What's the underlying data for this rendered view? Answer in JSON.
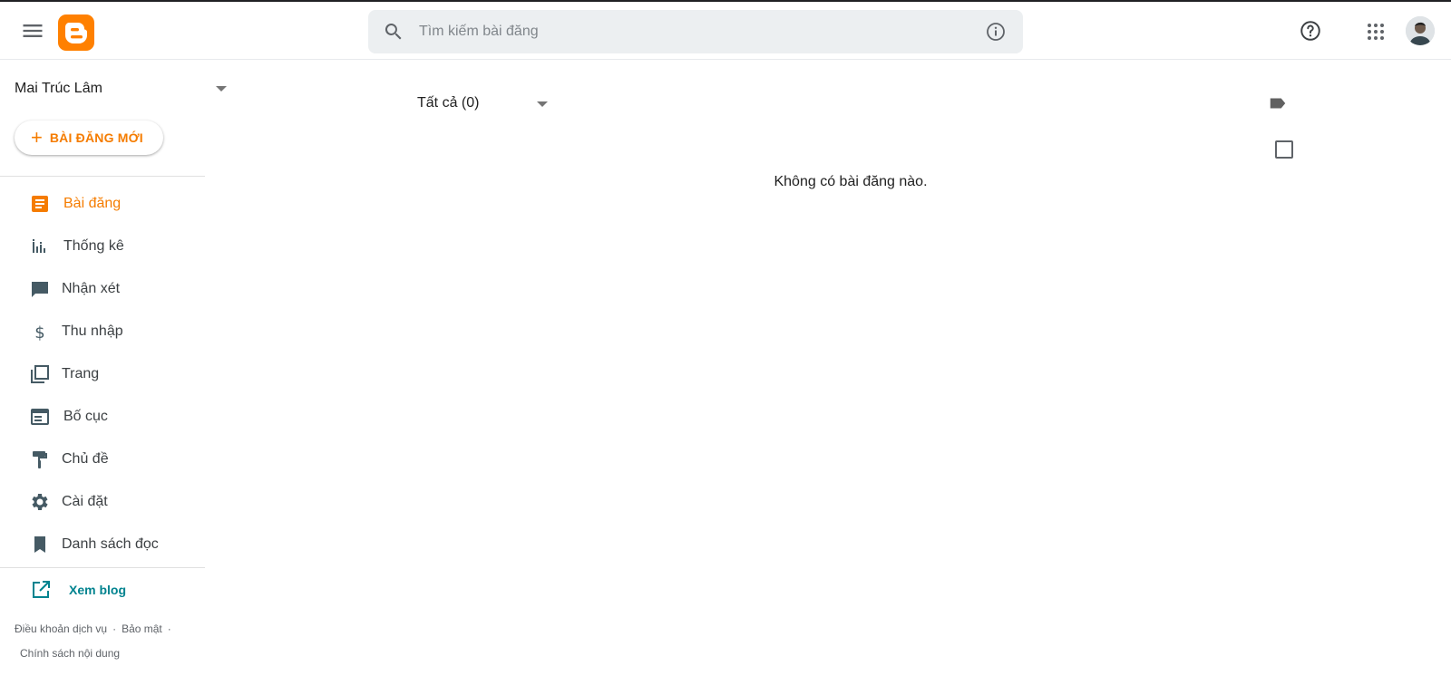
{
  "header": {
    "search_placeholder": "Tìm kiếm bài đăng"
  },
  "sidebar": {
    "blog_name": "Mai Trúc Lâm",
    "new_post_label": "BÀI ĐĂNG MỚI",
    "items": [
      {
        "label": "Bài đăng",
        "icon": "posts-icon",
        "active": true
      },
      {
        "label": "Thống kê",
        "icon": "stats-icon"
      },
      {
        "label": "Nhận xét",
        "icon": "comment-icon"
      },
      {
        "label": "Thu nhập",
        "icon": "dollar-icon"
      },
      {
        "label": "Trang",
        "icon": "pages-icon"
      },
      {
        "label": "Bố cục",
        "icon": "layout-icon"
      },
      {
        "label": "Chủ đề",
        "icon": "paint-roller-icon"
      },
      {
        "label": "Cài đặt",
        "icon": "gear-icon"
      },
      {
        "label": "Danh sách đọc",
        "icon": "bookmark-icon"
      }
    ],
    "view_blog_label": "Xem blog",
    "footer": {
      "terms": "Điều khoản dịch vụ",
      "privacy": "Bảo mật",
      "content_policy": "Chính sách nội dung"
    }
  },
  "main": {
    "filter_label": "Tất cả (0)",
    "empty_message": "Không có bài đăng nào."
  },
  "colors": {
    "accent": "#f57c00",
    "link": "#00838f",
    "icon": "#455a64"
  }
}
